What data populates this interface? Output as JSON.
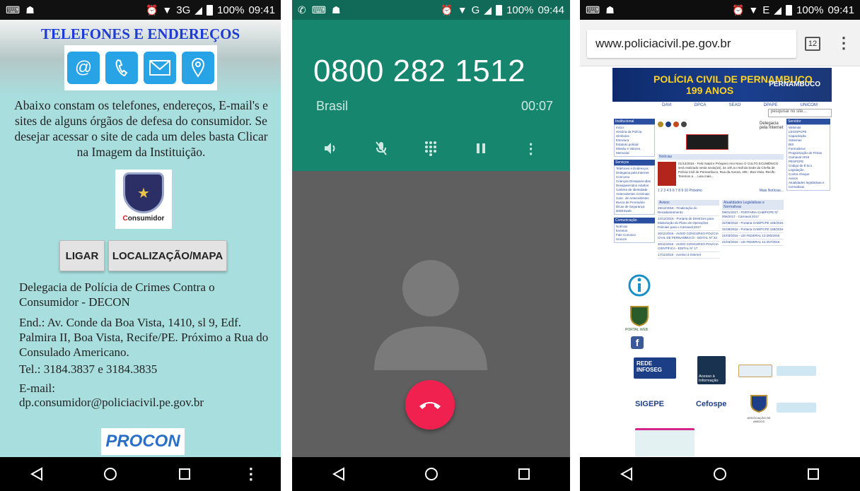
{
  "phone1": {
    "status": {
      "time": "09:41",
      "battery": "100%",
      "network": "3G"
    },
    "title": "TELEFONES E ENDEREÇOS",
    "contact_icons": [
      "at-icon",
      "phone-icon",
      "envelope-icon",
      "location-pin-icon"
    ],
    "intro": "Abaixo constam os telefones, endereços, E-mail's e sites de alguns órgãos de defesa do consumidor.  Se desejar acessar o site de cada um deles basta Clicar na Imagem da Instituição.",
    "logo_word_1": "onsumidor",
    "buttons": {
      "call": "LIGAR",
      "map": "LOCALIZAÇÃO/MAPA"
    },
    "agency": "Delegacia de Polícia de Crimes Contra o Consumidor - DECON",
    "address": "End.: Av. Conde da Boa Vista, 1410, sl 9, Edf. Palmira II, Boa Vista, Recife/PE. Próximo a Rua do Consulado Americano.",
    "phones": "Tel.: 3184.3837 e 3184.3835",
    "email_label": "E-mail:",
    "email": "dp.consumidor@policiacivil.pe.gov.br",
    "next_logo": "PROCON"
  },
  "phone2": {
    "status": {
      "time": "09:44",
      "battery": "100%",
      "network": "G"
    },
    "number": "0800 282 1512",
    "country": "Brasil",
    "timer": "00:07",
    "actions": [
      "speaker-icon",
      "mute-icon",
      "dialpad-icon",
      "pause-icon",
      "more-icon"
    ]
  },
  "phone3": {
    "status": {
      "time": "09:41",
      "battery": "100%",
      "network": "E"
    },
    "url": "www.policiacivil.pe.gov.br",
    "tab_count": "12",
    "site": {
      "title": "POLÍCIA CIVIL DE PERNAMBUCO",
      "years": "199 ANOS",
      "state": "PERNAMBUCO",
      "search_placeholder": "pesquisar no site...",
      "menu": [
        "DAVI",
        "DPCA",
        "SEAO",
        "DPAPE",
        "UNICOM"
      ],
      "left_blocks": [
        {
          "head": "Institucional",
          "items": [
            "Início",
            "História da Polícia",
            "Símbolos",
            "Estrutura",
            "Estatuto policial",
            "Missão e Valores",
            "Memorial"
          ]
        },
        {
          "head": "Serviços",
          "items": [
            "Telefones e Endereços",
            "Delegacia pela Internet",
            "Concurso",
            "Crianças Desaparecidas",
            "Desaparecidos Adultos",
            "Carteira de Identidade",
            "Antecedentes Criminais",
            "Canc. de Antecedentes",
            "Busca de Prontuário",
            "Dicas de Segurança",
            "DIEESweb"
          ]
        },
        {
          "head": "Comunicação",
          "items": [
            "Notícias",
            "Eventos",
            "Fale Conosco",
            "Unicom"
          ]
        }
      ],
      "right_blocks": [
        {
          "head": "Servidor",
          "items": [
            "Webmail",
            "LEGISPCPE",
            "Capacitação",
            "Sistemas",
            "BIS",
            "Formulários",
            "Programação de Férias",
            "Carnaval 2016",
            "PESPCPE",
            "Código de É tico",
            "Legislação",
            "Contra cheque",
            "Avisos",
            "Atualidades legislativas e normativas"
          ]
        }
      ],
      "internet_label": "Delegacia pela Internet",
      "news_head": "Notícias",
      "news_text": "01/12/2016 - Feliz Natal e Próspero Ano Novo O CULTO ECUMÊNICO será realizado nesta sexta(16), às 10h,no Hall da Sede da Chefia de Polícia Civil de Pernambuco, Rua da Aurora, 405 - Boa Vista -Recife. Teremos a ...  Leia mais...",
      "pages": "1 2 3 4 5 6 7 8 9 10  Próximo",
      "more_news": "Mais Notícias...",
      "avisos_head": "Avisos",
      "avisos": [
        "28/12/2016 - Finalização do Recadastramento",
        "12/12/2016 - Portaria de Diretrizes para Elaboração do Plano de Operações Policiais para o Carnaval 2017",
        "30/11/2016 - AVISO CONCURSO POLÍCIA CIVIL DE PERNAMBUCO - EDITAL Nº 23",
        "30/11/2016 - AVISO CONCURSO POLÍCIA CIENTÍFICA - EDITAL Nº 17",
        "17/11/2016 - Acesso à Internet"
      ],
      "atual_head": "Atualidades Legislativas e Normativas",
      "atual": [
        "09/01/2017 - PORTARIA GAB/PCPE Nº 006/2017 - Carnaval 2017",
        "31/08/2016 - Portaria GAB/PCPE 156/2016",
        "31/08/2016 - Portaria GAB/PCPE 158/2016",
        "21/03/2016 - LEI FEDERAL 13.260/2016",
        "21/03/2016 - LEI FEDERAL 13.257/2016"
      ],
      "portal_label": "PORTAL WEB",
      "rede": "REDE INFOSEG",
      "acesso": "Acesso à Informação",
      "sigepe": "SIGEPE",
      "cefospe": "Cefospe",
      "associacao": "ASSOCIAÇÃO DE AMIGOS"
    }
  },
  "colors": {
    "p1_bg": "#a8dede",
    "p1_title": "#1f3bd6",
    "icon_blue": "#28a3e6",
    "call_green": "#16866f",
    "hangup": "#f0214f"
  }
}
